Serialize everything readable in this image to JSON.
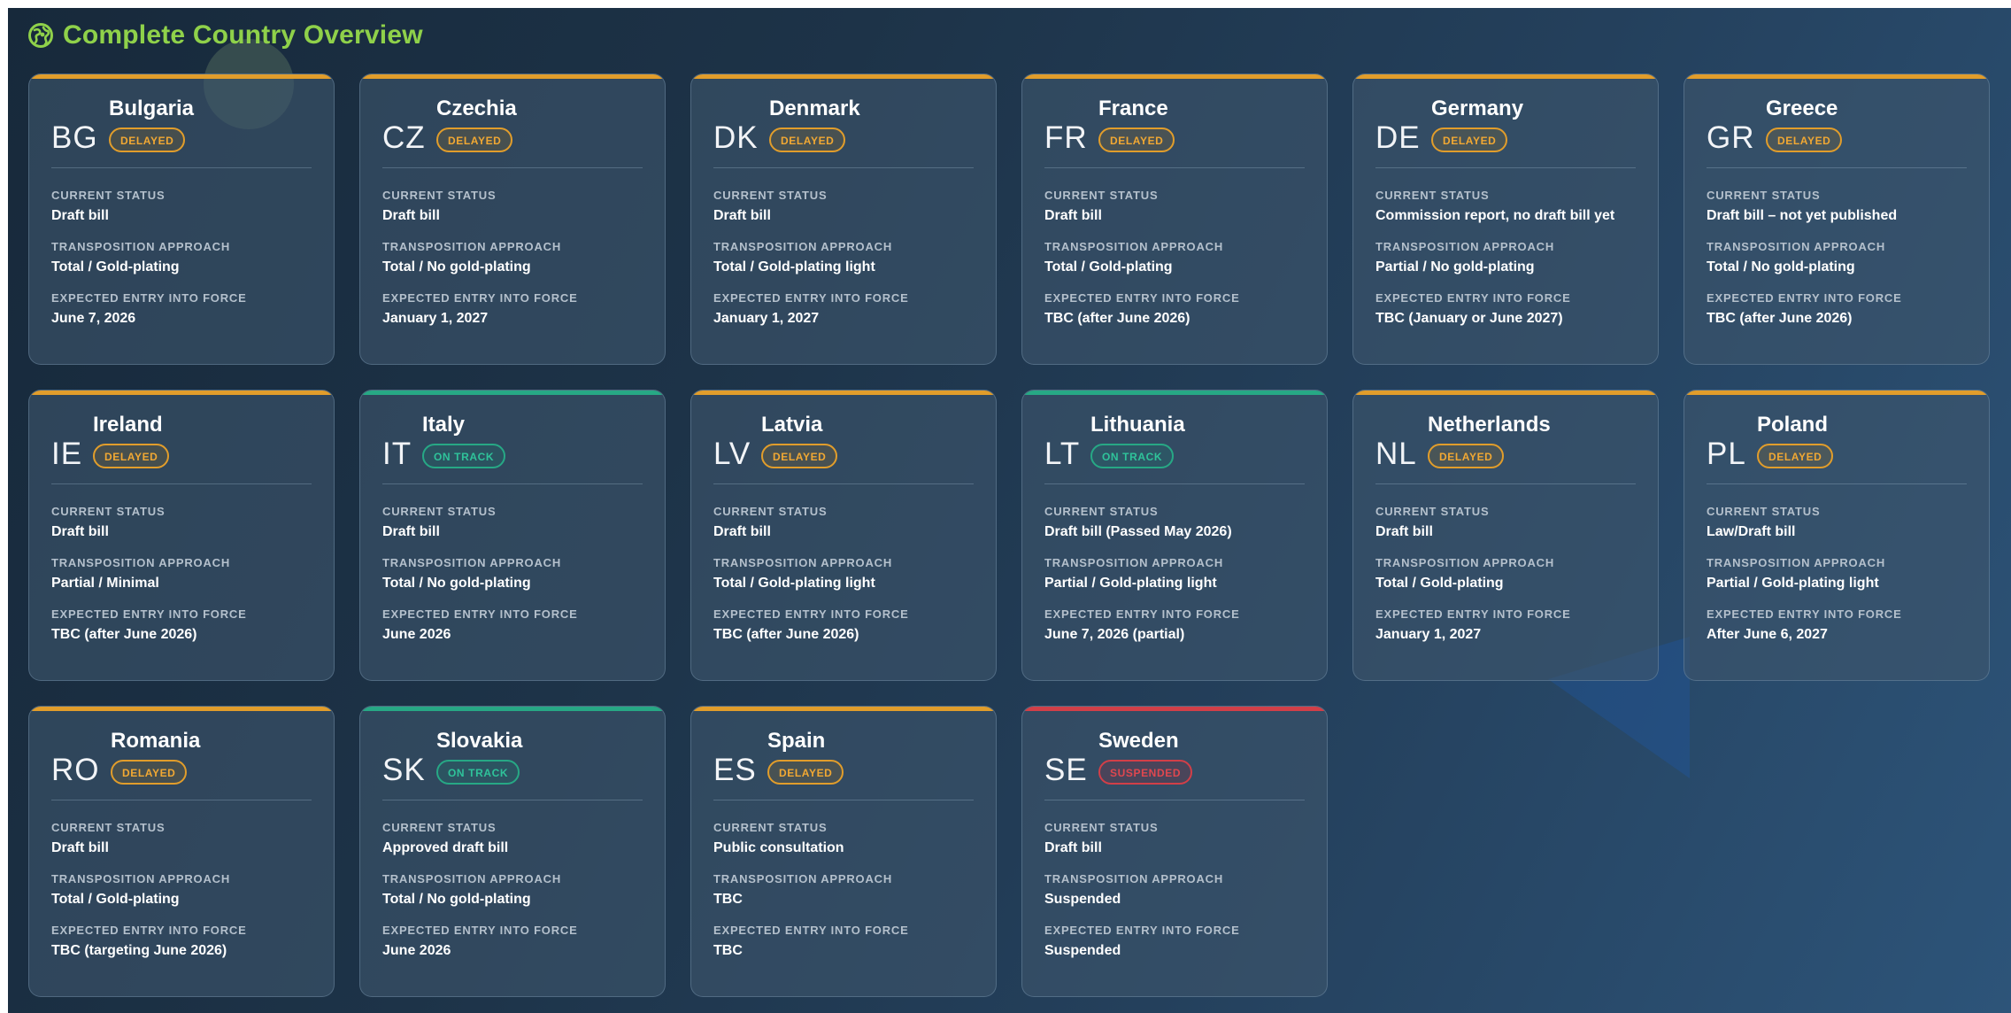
{
  "header": {
    "title": "Complete Country Overview",
    "icon": "globe-icon"
  },
  "labels": {
    "current_status": "CURRENT STATUS",
    "transposition_approach": "TRANSPOSITION APPROACH",
    "expected_entry": "EXPECTED ENTRY INTO FORCE"
  },
  "colors": {
    "title_green": "#8fd14a",
    "delayed": "#e19d2b",
    "on_track": "#27a885",
    "suspended": "#d23f48"
  },
  "countries": [
    {
      "code": "BG",
      "name": "Bulgaria",
      "badge": "DELAYED",
      "status_type": "delayed",
      "current_status": "Draft bill",
      "approach": "Total / Gold-plating",
      "entry": "June 7, 2026"
    },
    {
      "code": "CZ",
      "name": "Czechia",
      "badge": "DELAYED",
      "status_type": "delayed",
      "current_status": "Draft bill",
      "approach": "Total / No gold-plating",
      "entry": "January 1, 2027"
    },
    {
      "code": "DK",
      "name": "Denmark",
      "badge": "DELAYED",
      "status_type": "delayed",
      "current_status": "Draft bill",
      "approach": "Total / Gold-plating light",
      "entry": "January 1, 2027"
    },
    {
      "code": "FR",
      "name": "France",
      "badge": "DELAYED",
      "status_type": "delayed",
      "current_status": "Draft bill",
      "approach": "Total / Gold-plating",
      "entry": "TBC (after June 2026)"
    },
    {
      "code": "DE",
      "name": "Germany",
      "badge": "DELAYED",
      "status_type": "delayed",
      "current_status": "Commission report, no draft bill yet",
      "approach": "Partial / No gold-plating",
      "entry": "TBC (January or June 2027)"
    },
    {
      "code": "GR",
      "name": "Greece",
      "badge": "DELAYED",
      "status_type": "delayed",
      "current_status": "Draft bill – not yet published",
      "approach": "Total / No gold-plating",
      "entry": "TBC (after June 2026)"
    },
    {
      "code": "IE",
      "name": "Ireland",
      "badge": "DELAYED",
      "status_type": "delayed",
      "current_status": "Draft bill",
      "approach": "Partial / Minimal",
      "entry": "TBC (after June 2026)"
    },
    {
      "code": "IT",
      "name": "Italy",
      "badge": "ON TRACK",
      "status_type": "ontrack",
      "current_status": "Draft bill",
      "approach": "Total / No gold-plating",
      "entry": "June 2026"
    },
    {
      "code": "LV",
      "name": "Latvia",
      "badge": "DELAYED",
      "status_type": "delayed",
      "current_status": "Draft bill",
      "approach": "Total / Gold-plating light",
      "entry": "TBC (after June 2026)"
    },
    {
      "code": "LT",
      "name": "Lithuania",
      "badge": "ON TRACK",
      "status_type": "ontrack",
      "current_status": "Draft bill (Passed May 2026)",
      "approach": "Partial / Gold-plating light",
      "entry": "June 7, 2026 (partial)"
    },
    {
      "code": "NL",
      "name": "Netherlands",
      "badge": "DELAYED",
      "status_type": "delayed",
      "current_status": "Draft bill",
      "approach": "Total / Gold-plating",
      "entry": "January 1, 2027"
    },
    {
      "code": "PL",
      "name": "Poland",
      "badge": "DELAYED",
      "status_type": "delayed",
      "current_status": "Law/Draft bill",
      "approach": "Partial / Gold-plating light",
      "entry": "After June 6, 2027"
    },
    {
      "code": "RO",
      "name": "Romania",
      "badge": "DELAYED",
      "status_type": "delayed",
      "current_status": "Draft bill",
      "approach": "Total / Gold-plating",
      "entry": "TBC (targeting June 2026)"
    },
    {
      "code": "SK",
      "name": "Slovakia",
      "badge": "ON TRACK",
      "status_type": "ontrack",
      "current_status": "Approved draft bill",
      "approach": "Total / No gold-plating",
      "entry": "June 2026"
    },
    {
      "code": "ES",
      "name": "Spain",
      "badge": "DELAYED",
      "status_type": "delayed",
      "current_status": "Public consultation",
      "approach": "TBC",
      "entry": "TBC"
    },
    {
      "code": "SE",
      "name": "Sweden",
      "badge": "SUSPENDED",
      "status_type": "suspended",
      "current_status": "Draft bill",
      "approach": "Suspended",
      "entry": "Suspended"
    }
  ]
}
